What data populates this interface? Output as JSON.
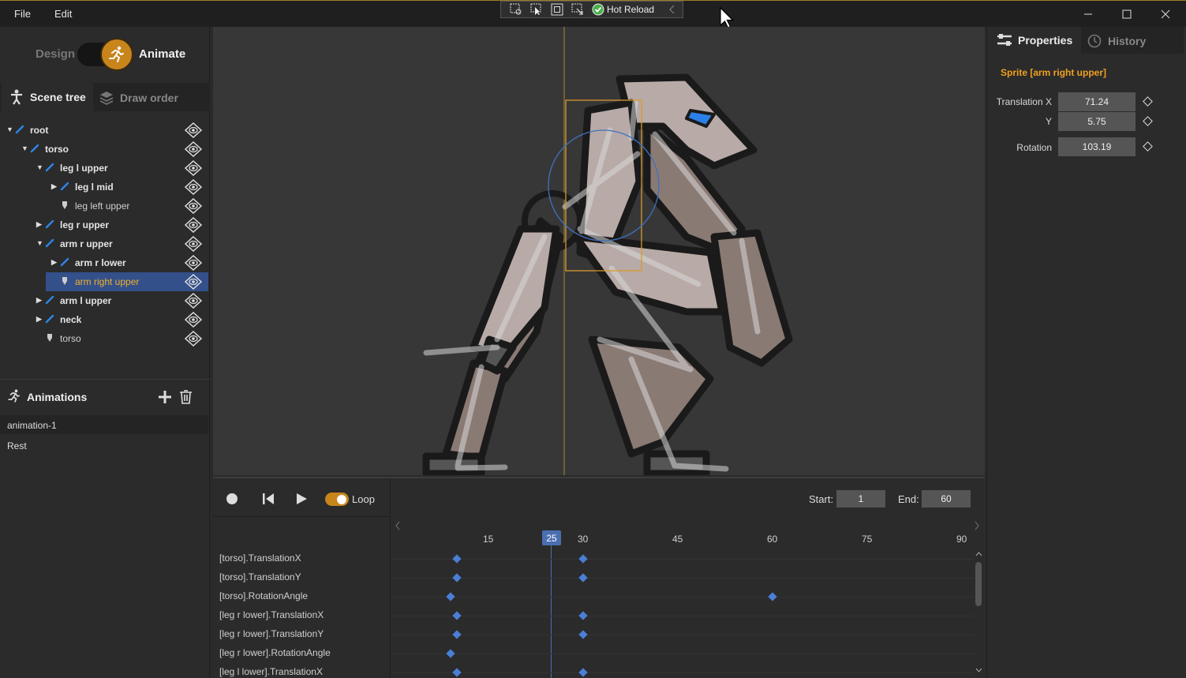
{
  "menu": {
    "file": "File",
    "edit": "Edit"
  },
  "toolbar": {
    "hot_reload": "Hot Reload",
    "icons": [
      "select-settings-icon",
      "pointer-icon",
      "frame-icon",
      "transform-icon",
      "check-icon",
      "chevron-left-icon"
    ]
  },
  "mode": {
    "design": "Design",
    "animate": "Animate",
    "active": "Animate"
  },
  "left_tabs": {
    "scene_tree": "Scene tree",
    "draw_order": "Draw order",
    "active": "Scene tree"
  },
  "tree": [
    {
      "label": "root",
      "type": "bone",
      "expanded": true
    },
    {
      "label": "torso",
      "type": "bone",
      "expanded": true
    },
    {
      "label": "leg l upper",
      "type": "bone",
      "expanded": true
    },
    {
      "label": "leg l mid",
      "type": "bone",
      "expanded": false
    },
    {
      "label": "leg  left upper",
      "type": "sprite"
    },
    {
      "label": "leg r upper",
      "type": "bone",
      "expanded": false
    },
    {
      "label": "arm r upper",
      "type": "bone",
      "expanded": true
    },
    {
      "label": "arm r lower",
      "type": "bone",
      "expanded": false
    },
    {
      "label": "arm right upper",
      "type": "sprite",
      "selected": true
    },
    {
      "label": "arm l upper",
      "type": "bone",
      "expanded": false
    },
    {
      "label": "neck",
      "type": "bone",
      "expanded": false
    },
    {
      "label": "torso",
      "type": "sprite"
    }
  ],
  "animations": {
    "title": "Animations",
    "items": [
      "animation-1",
      "Rest"
    ],
    "selected": "animation-1"
  },
  "playback": {
    "loop_label": "Loop",
    "loop_on": true,
    "start_label": "Start:",
    "start_value": "1",
    "end_label": "End:",
    "end_value": "60"
  },
  "timeline": {
    "ticks": [
      "15",
      "30",
      "45",
      "60",
      "75",
      "90"
    ],
    "current_frame": "25",
    "tracks": [
      {
        "name": "[torso].TranslationX",
        "keys": [
          10,
          30
        ]
      },
      {
        "name": "[torso].TranslationY",
        "keys": [
          10,
          30
        ]
      },
      {
        "name": "[torso].RotationAngle",
        "keys": [
          9,
          60
        ]
      },
      {
        "name": "[leg r lower].TranslationX",
        "keys": [
          10,
          30
        ]
      },
      {
        "name": "[leg r lower].TranslationY",
        "keys": [
          10,
          30
        ]
      },
      {
        "name": "[leg r lower].RotationAngle",
        "keys": [
          9
        ]
      },
      {
        "name": "[leg l lower].TranslationX",
        "keys": [
          10,
          30
        ]
      }
    ]
  },
  "right_tabs": {
    "properties": "Properties",
    "history": "History",
    "active": "Properties"
  },
  "properties": {
    "title": "Sprite [arm right upper]",
    "translation_x_label": "Translation X",
    "translation_x": "71.24",
    "y_label": "Y",
    "y": "5.75",
    "rotation_label": "Rotation",
    "rotation": "103.19"
  },
  "colors": {
    "accent": "#f0a020",
    "keyframe": "#4a7fd6",
    "selection": "#33508a",
    "bone": "#2e86e8"
  }
}
